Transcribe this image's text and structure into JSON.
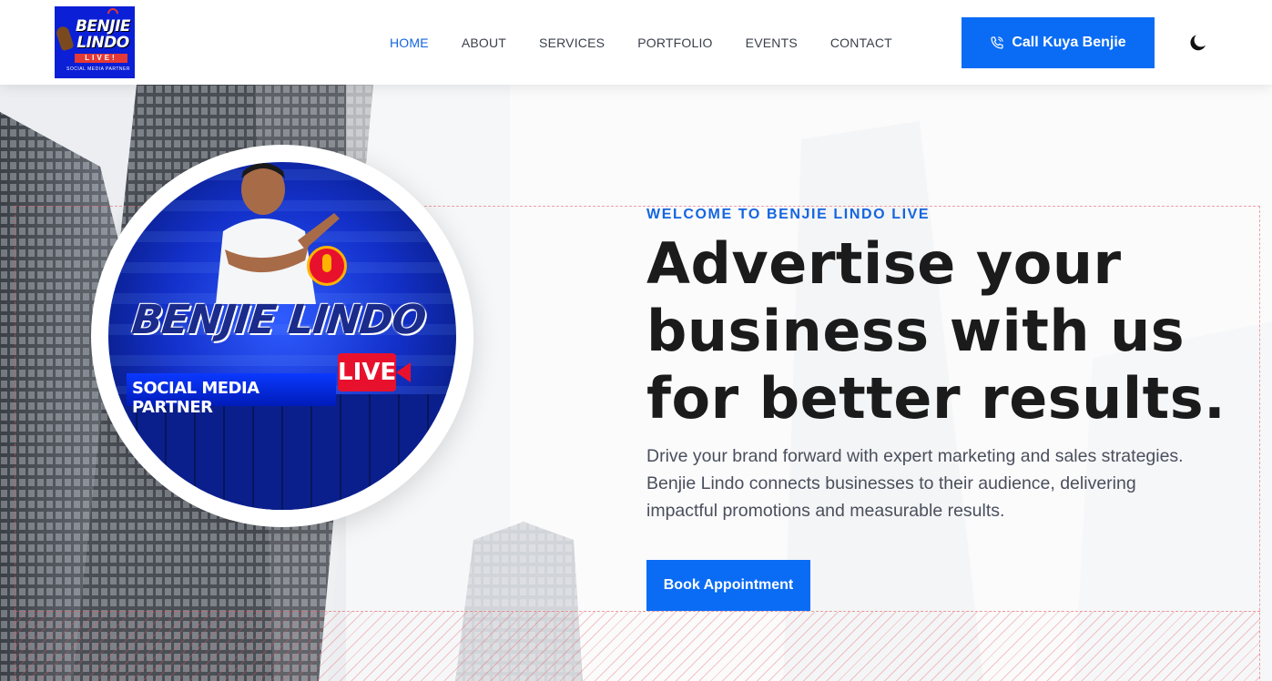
{
  "header": {
    "logo": {
      "line1": "BENJIE",
      "line2": "LINDO",
      "line3": "LIVE!",
      "line4": "SOCIAL MEDIA PARTNER"
    },
    "nav": [
      {
        "label": "HOME",
        "active": true
      },
      {
        "label": "ABOUT",
        "active": false
      },
      {
        "label": "SERVICES",
        "active": false
      },
      {
        "label": "PORTFOLIO",
        "active": false
      },
      {
        "label": "EVENTS",
        "active": false
      },
      {
        "label": "CONTACT",
        "active": false
      }
    ],
    "call_button": {
      "label": "Call Kuya Benjie",
      "icon": "phone-icon"
    },
    "theme_toggle": {
      "icon": "moon-icon"
    }
  },
  "hero": {
    "badge": {
      "title": "BENJIE LINDO",
      "subtitle": "SOCIAL MEDIA PARTNER",
      "live": "LIVE"
    },
    "eyebrow": "WELCOME TO BENJIE LINDO LIVE",
    "headline": "Advertise your business with us for better results.",
    "lead": "Drive your brand forward with expert marketing and sales strategies. Benjie Lindo connects businesses to their audience, delivering impactful promotions and measurable results.",
    "cta": "Book Appointment"
  },
  "colors": {
    "accent": "#0a6cf5",
    "nav_active": "#1565e0",
    "heading": "#1b1b1b",
    "body_text": "#4a4f5c",
    "live_red": "#e8112d",
    "logo_blue": "#0a1fd6"
  }
}
